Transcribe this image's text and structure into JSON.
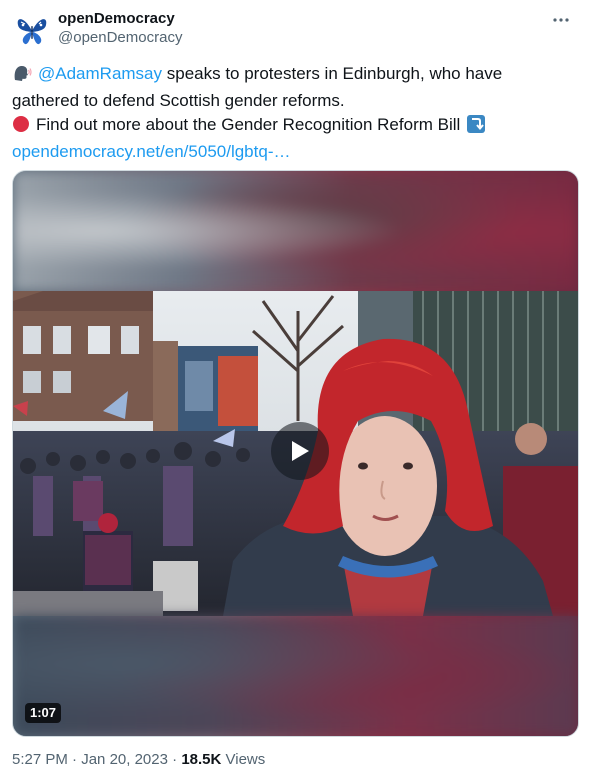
{
  "author": {
    "display_name": "openDemocracy",
    "handle": "@openDemocracy"
  },
  "tweet": {
    "mention": "@AdamRamsay",
    "line1_rest": " speaks to protesters in Edinburgh, who have gathered to defend Scottish gender reforms.",
    "line2": "Find out more about the Gender Recognition Reform Bill",
    "link": "opendemocracy.net/en/5050/lgbtq-…"
  },
  "video": {
    "duration": "1:07"
  },
  "meta": {
    "time": "5:27 PM",
    "dot": " · ",
    "date": "Jan 20, 2023",
    "views_count": "18.5K",
    "views_label": " Views"
  },
  "icons": {
    "avatar": "butterfly-logo",
    "speaking": "speaking-head-icon",
    "red_circle": "red-circle-icon",
    "arrow": "arrow-down-icon",
    "play": "play-icon",
    "more": "more-icon"
  },
  "colors": {
    "link": "#1d9bf0",
    "text": "#0f1419",
    "secondary": "#536471",
    "red_dot": "#e0245e"
  }
}
